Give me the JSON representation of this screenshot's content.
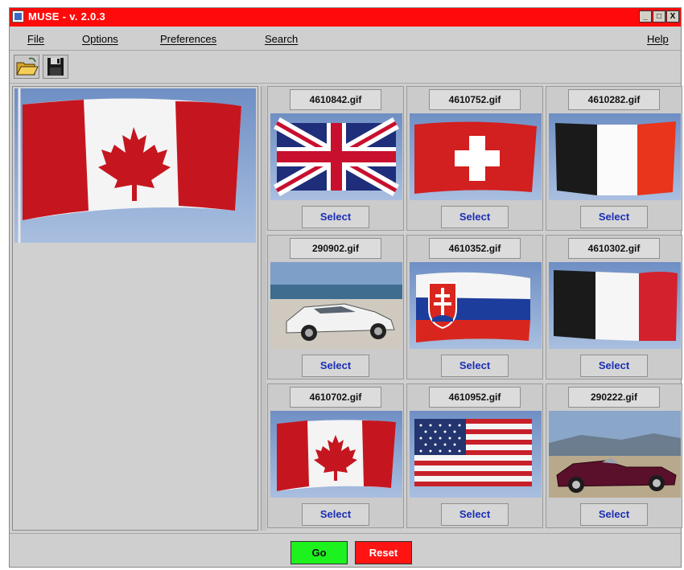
{
  "window": {
    "title": "MUSE - v. 2.0.3",
    "controls": [
      "_",
      "□",
      "X"
    ]
  },
  "menu": {
    "file": "File",
    "options": "Options",
    "preferences": "Preferences",
    "search": "Search",
    "help": "Help"
  },
  "toolbar": {
    "open_icon": "open-folder-icon",
    "save_icon": "floppy-disk-icon"
  },
  "query_image": {
    "subject": "canada-flag"
  },
  "results": [
    {
      "filename": "4610842.gif",
      "subject": "uk-flag",
      "select_label": "Select"
    },
    {
      "filename": "4610752.gif",
      "subject": "swiss-flag",
      "select_label": "Select"
    },
    {
      "filename": "4610282.gif",
      "subject": "tricolor-flag",
      "select_label": "Select"
    },
    {
      "filename": "290902.gif",
      "subject": "white-sports-car",
      "select_label": "Select"
    },
    {
      "filename": "4610352.gif",
      "subject": "slovakia-flag",
      "select_label": "Select"
    },
    {
      "filename": "4610302.gif",
      "subject": "tricolor-flag",
      "select_label": "Select"
    },
    {
      "filename": "4610702.gif",
      "subject": "canada-flag",
      "select_label": "Select"
    },
    {
      "filename": "4610952.gif",
      "subject": "usa-flag",
      "select_label": "Select"
    },
    {
      "filename": "290222.gif",
      "subject": "purple-roadster",
      "select_label": "Select"
    }
  ],
  "actions": {
    "go_label": "Go",
    "reset_label": "Reset"
  },
  "colors": {
    "title_bar": "#ff0a0a",
    "go": "#1ef21e",
    "reset": "#ff1414",
    "select_text": "#1b2fb5"
  }
}
